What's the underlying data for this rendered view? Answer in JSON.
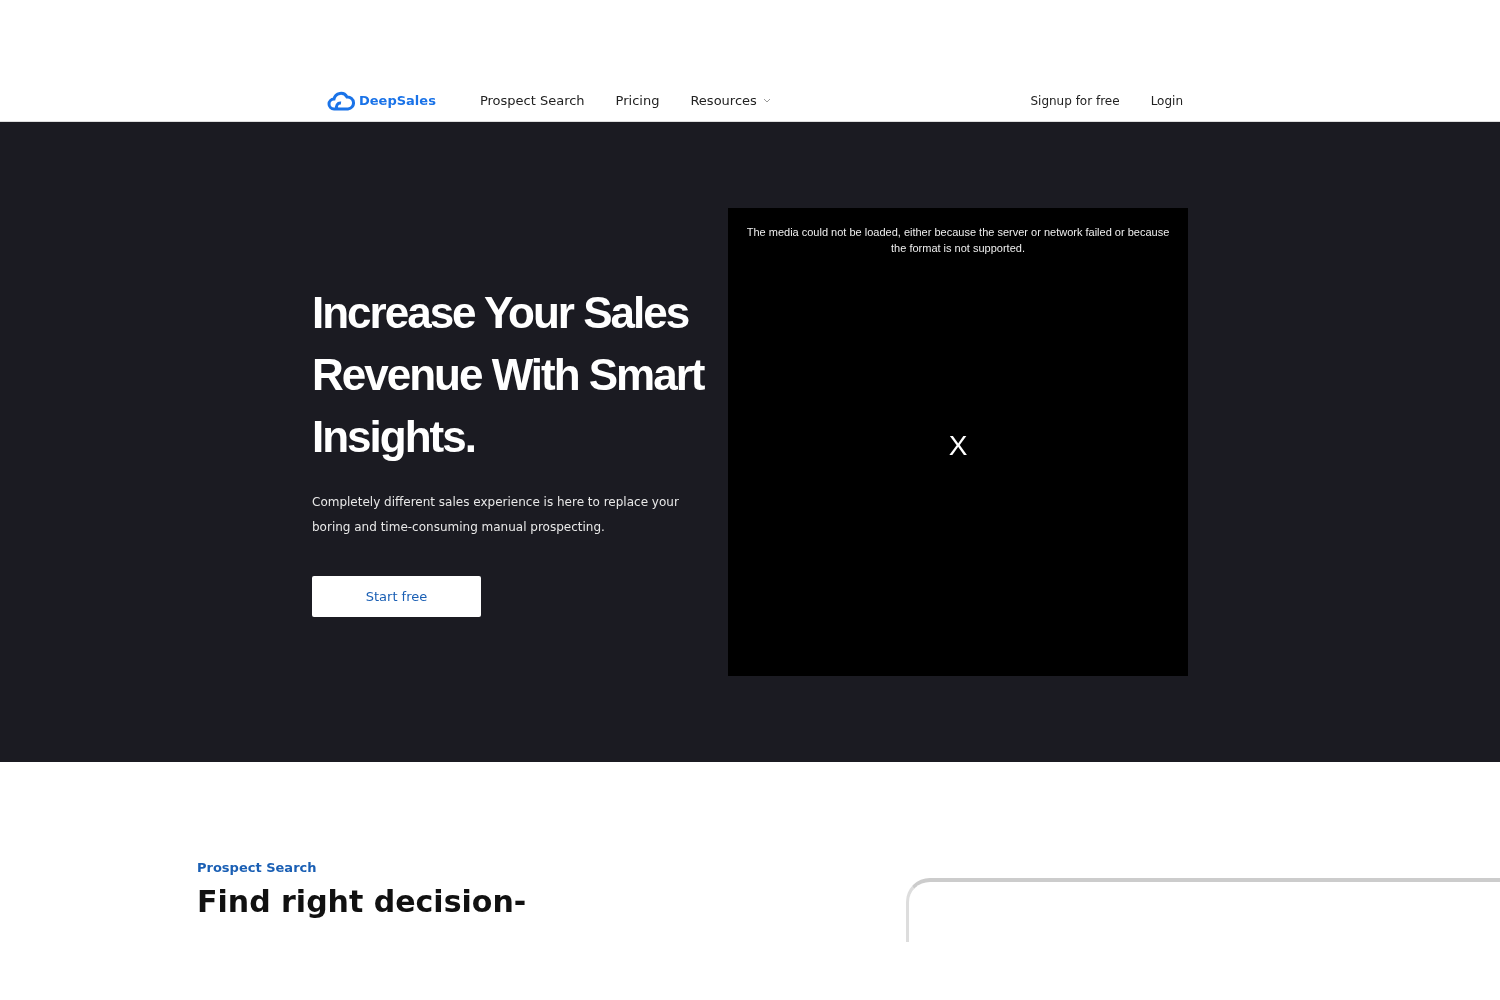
{
  "nav": {
    "logo": "DeepSales",
    "links": [
      {
        "label": "Prospect Search",
        "kind": "link"
      },
      {
        "label": "Pricing",
        "kind": "link"
      },
      {
        "label": "Resources",
        "kind": "dropdown"
      }
    ],
    "actions": [
      "Signup for free",
      "Login"
    ]
  },
  "hero": {
    "title": "Increase Your Sales Revenue With Smart Insights.",
    "subtitle": "Completely different sales experience is here to replace your boring and time-consuming manual prospecting.",
    "button": "Start free",
    "video": {
      "error": "The media could not be loaded, either because the server or network failed or because the format is not supported.",
      "close": "X"
    }
  },
  "section": {
    "eyebrow": "Prospect Search",
    "heading": "Find right decision-"
  }
}
